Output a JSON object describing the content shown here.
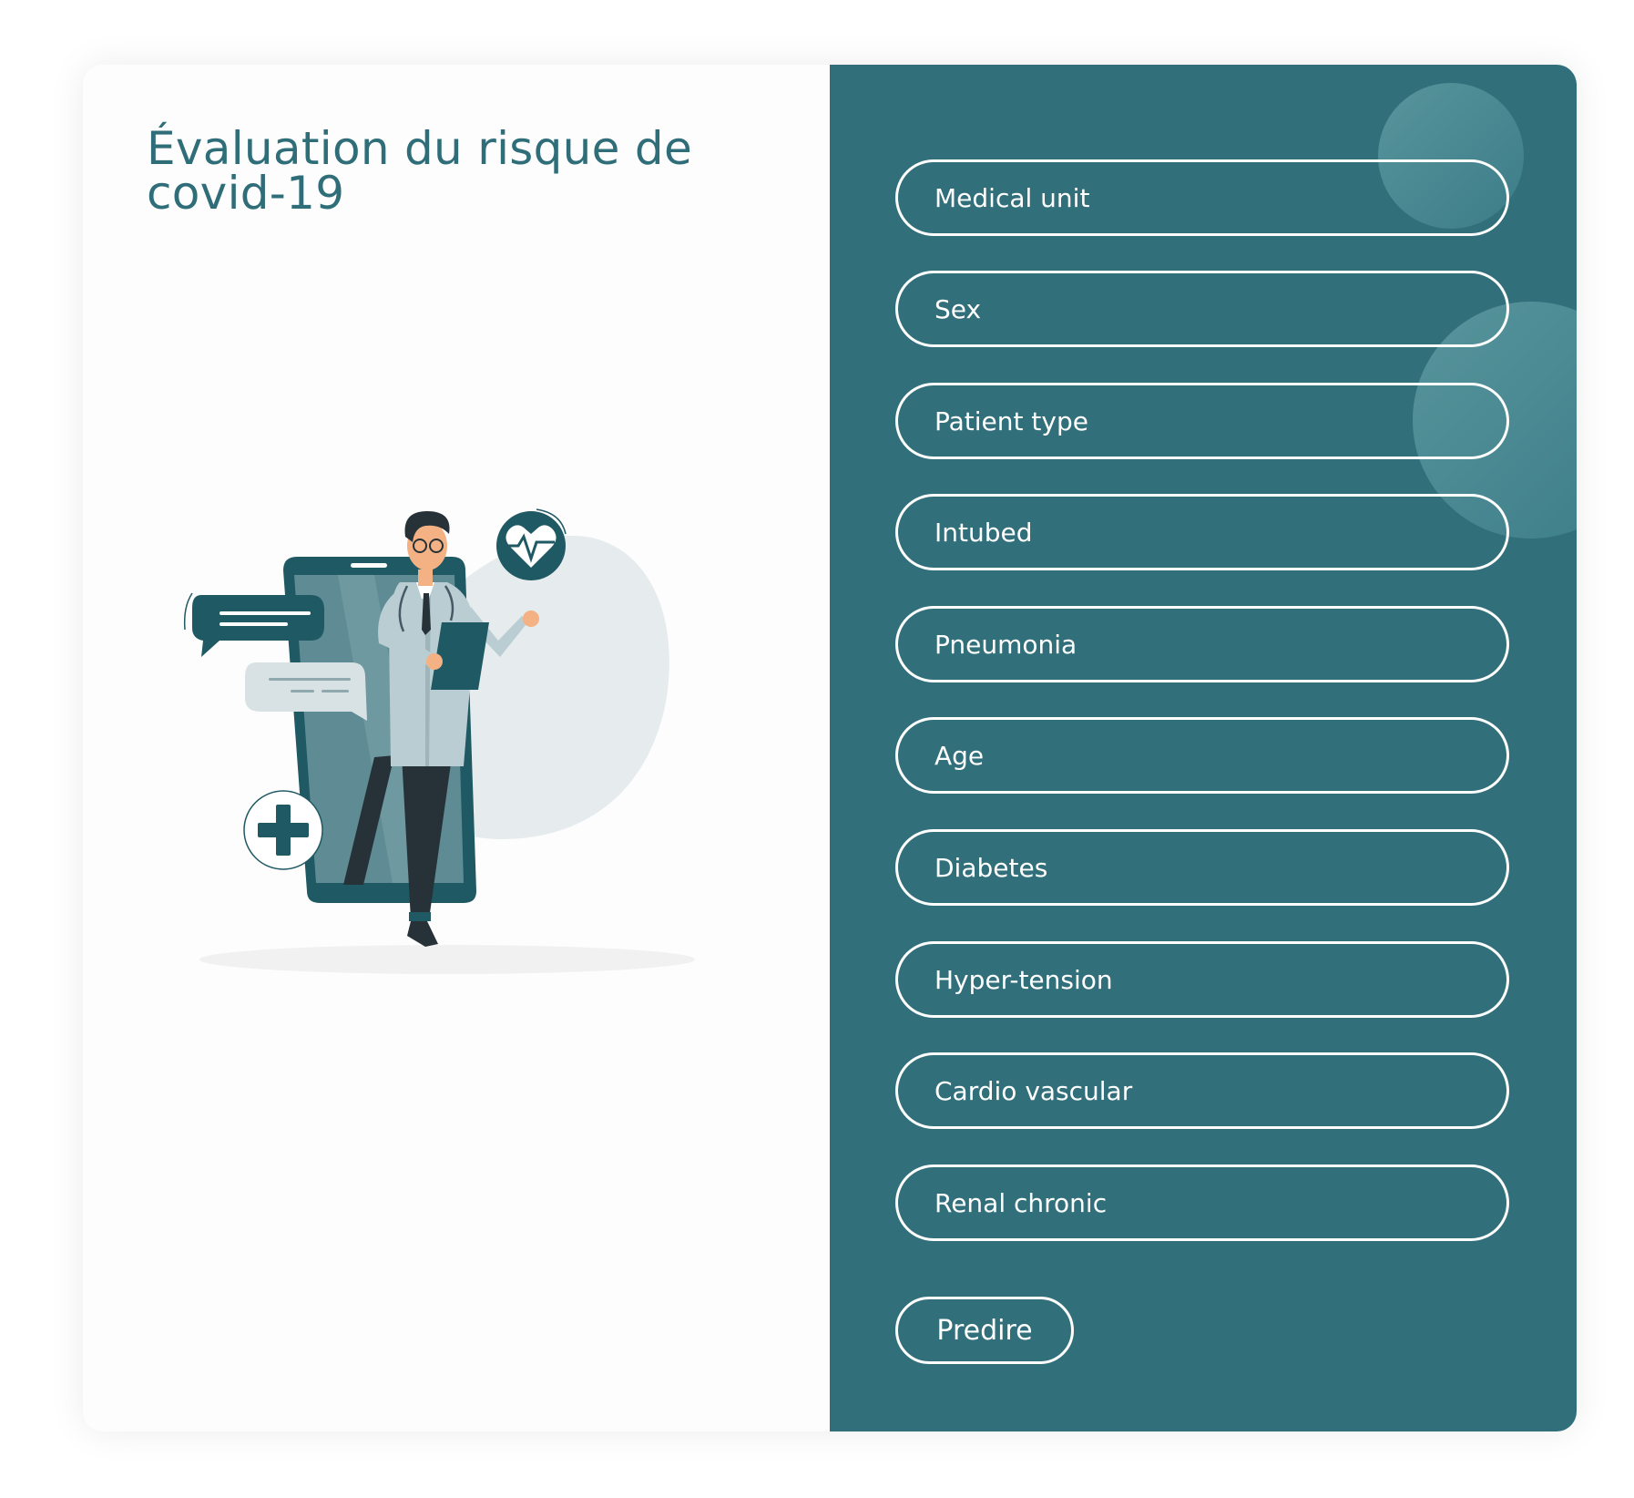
{
  "page": {
    "title": "Évaluation du risque de covid-19"
  },
  "form": {
    "fields": [
      {
        "name": "medical-unit-field",
        "placeholder": "Medical unit"
      },
      {
        "name": "sex-field",
        "placeholder": "Sex"
      },
      {
        "name": "patient-type-field",
        "placeholder": "Patient type"
      },
      {
        "name": "intubed-field",
        "placeholder": "Intubed"
      },
      {
        "name": "pneumonia-field",
        "placeholder": "Pneumonia"
      },
      {
        "name": "age-field",
        "placeholder": "Age"
      },
      {
        "name": "diabetes-field",
        "placeholder": "Diabetes"
      },
      {
        "name": "hyper-tension-field",
        "placeholder": "Hyper-tension"
      },
      {
        "name": "cardio-vascular-field",
        "placeholder": "Cardio vascular"
      },
      {
        "name": "renal-chronic-field",
        "placeholder": "Renal chronic"
      }
    ],
    "submit_label": "Predire"
  },
  "colors": {
    "accent": "#316f7b",
    "title": "#2f6e79",
    "dark": "#1f5963",
    "light": "#e6eced"
  },
  "illustration": {
    "icons": [
      "doctor-illustration",
      "phone-icon",
      "heart-rate-icon",
      "chat-bubble-icon",
      "plus-icon"
    ]
  }
}
